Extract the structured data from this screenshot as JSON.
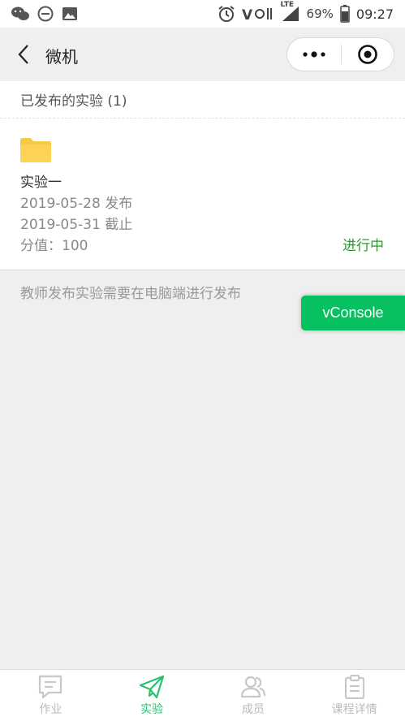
{
  "statusbar": {
    "battery_percent": "69%",
    "time": "09:27",
    "network_label": "LTE",
    "icons": [
      "wechat-icon",
      "dnd-icon",
      "image-icon",
      "alarm-icon",
      "volte-icon",
      "signal-icon",
      "battery-icon"
    ]
  },
  "navbar": {
    "title": "微机"
  },
  "section": {
    "title": "已发布的实验 (1)"
  },
  "experiments": [
    {
      "name": "实验一",
      "published": "2019-05-28 发布",
      "deadline": "2019-05-31 截止",
      "score": "分值：100",
      "status": "进行中"
    }
  ],
  "hint": "教师发布实验需要在电脑端进行发布",
  "vconsole": "vConsole",
  "tabbar": {
    "tabs": [
      {
        "label": "作业",
        "icon": "homework-icon",
        "active": false
      },
      {
        "label": "实验",
        "icon": "send-icon",
        "active": true
      },
      {
        "label": "成员",
        "icon": "members-icon",
        "active": false
      },
      {
        "label": "课程详情",
        "icon": "clipboard-icon",
        "active": false
      }
    ]
  },
  "colors": {
    "accent": "#29c16f",
    "status_green": "#2a9d2a",
    "vconsole_bg": "#07c160",
    "folder": "#f7c843"
  }
}
